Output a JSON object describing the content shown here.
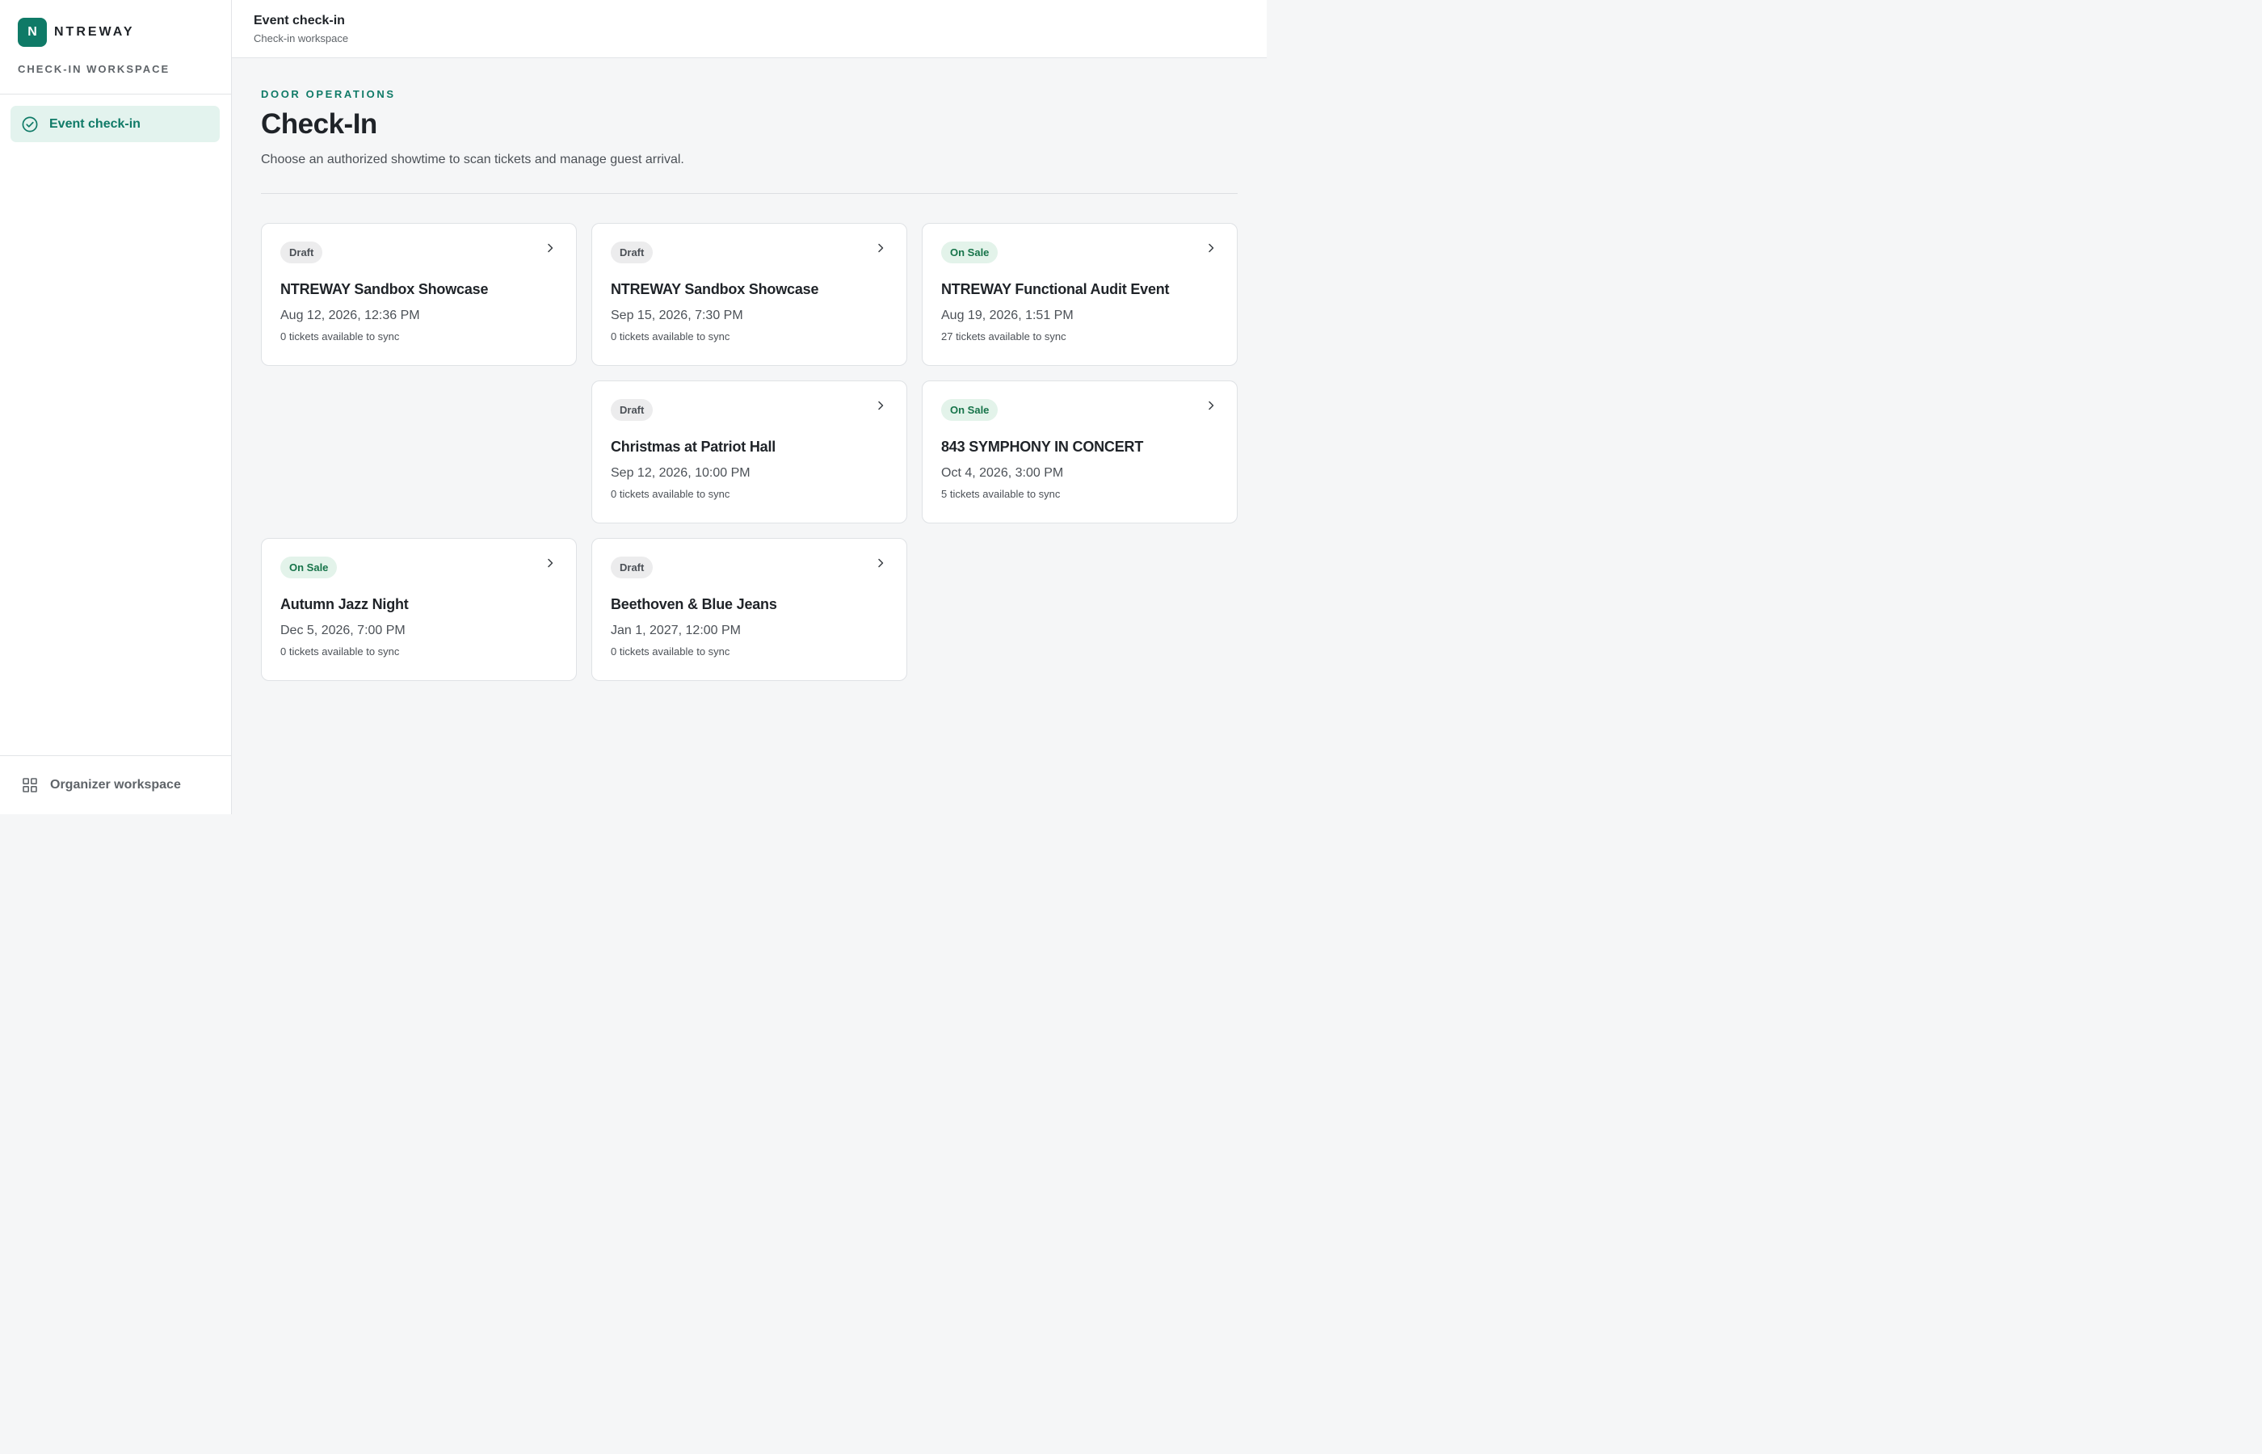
{
  "brand": {
    "initial": "N",
    "name": "NTREWAY"
  },
  "sidebar": {
    "workspace_label": "CHECK-IN WORKSPACE",
    "items": [
      {
        "label": "Event check-in",
        "icon": "check-circle-icon",
        "active": true
      }
    ],
    "bottom_item": {
      "label": "Organizer workspace",
      "icon": "grid-icon"
    }
  },
  "header": {
    "title": "Event check-in",
    "subtitle": "Check-in workspace"
  },
  "main": {
    "eyebrow": "DOOR OPERATIONS",
    "title": "Check-In",
    "description": "Choose an authorized showtime to scan tickets and manage guest arrival."
  },
  "events": [
    {
      "status": "Draft",
      "title": "NTREWAY Sandbox Showcase",
      "date": "Aug 12, 2026, 12:36 PM",
      "sync": "0 tickets available to sync"
    },
    {
      "status": "Draft",
      "title": "NTREWAY Sandbox Showcase",
      "date": "Sep 15, 2026, 7:30 PM",
      "sync": "0 tickets available to sync"
    },
    {
      "status": "On Sale",
      "title": "NTREWAY Functional Audit Event",
      "date": "Aug 19, 2026, 1:51 PM",
      "sync": "27 tickets available to sync"
    },
    {
      "status": "Draft",
      "title": "Christmas at Patriot Hall",
      "date": "Sep 12, 2026, 10:00 PM",
      "sync": "0 tickets available to sync"
    },
    {
      "status": "On Sale",
      "title": "843 SYMPHONY IN CONCERT",
      "date": "Oct 4, 2026, 3:00 PM",
      "sync": "5 tickets available to sync"
    },
    {
      "status": "On Sale",
      "title": "Autumn Jazz Night",
      "date": "Dec 5, 2026, 7:00 PM",
      "sync": "0 tickets available to sync"
    },
    {
      "status": "Draft",
      "title": "Beethoven & Blue Jeans",
      "date": "Jan 1, 2027, 12:00 PM",
      "sync": "0 tickets available to sync"
    }
  ],
  "colors": {
    "accent": "#0f7a67",
    "accent_bg": "#e3f3ee",
    "onsale_text": "#17744a",
    "onsale_bg": "#e3f3ea",
    "draft_bg": "#ececed"
  }
}
